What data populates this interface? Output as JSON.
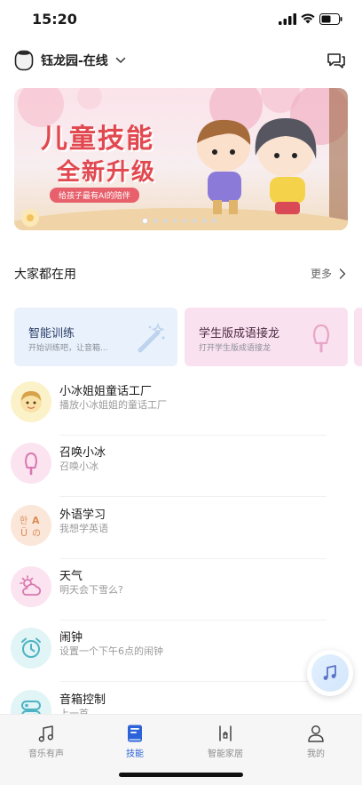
{
  "status_bar": {
    "time": "15:20"
  },
  "header": {
    "device_name": "钰龙园-在线"
  },
  "banner": {
    "title_line1": "儿童技能",
    "title_line2": "全新升级",
    "tagline": "给孩子最有AI的陪伴",
    "slide_count": 8,
    "active_slide": 1
  },
  "section": {
    "title": "大家都在用",
    "more_label": "更多"
  },
  "cards": [
    {
      "title": "智能训练",
      "subtitle": "开始训练吧，让音箱...",
      "icon": "magic-wand-icon",
      "color": "#e9f2fc"
    },
    {
      "title": "学生版成语接龙",
      "subtitle": "打开学生版成语接龙",
      "icon": "popsicle-icon",
      "color": "#fae1ef"
    }
  ],
  "list": [
    {
      "title": "小冰姐姐童话工厂",
      "subtitle": "播放小冰姐姐的童话工厂",
      "icon": "girl-avatar-icon",
      "bg": "#fbf2c9"
    },
    {
      "title": "召唤小冰",
      "subtitle": "召唤小冰",
      "icon": "popsicle-icon",
      "bg": "#fbe3f0"
    },
    {
      "title": "外语学习",
      "subtitle": "我想学英语",
      "icon": "language-icon",
      "bg": "#fbe7d9"
    },
    {
      "title": "天气",
      "subtitle": "明天会下雪么?",
      "icon": "weather-icon",
      "bg": "#fbe3f0"
    },
    {
      "title": "闹钟",
      "subtitle": "设置一个下午6点的闹钟",
      "icon": "alarm-clock-icon",
      "bg": "#e1f4f6"
    },
    {
      "title": "音箱控制",
      "subtitle": "上一首",
      "icon": "speaker-control-icon",
      "bg": "#e1f4f6"
    }
  ],
  "tabs": [
    {
      "label": "音乐有声",
      "icon": "music-note-icon",
      "active": false
    },
    {
      "label": "技能",
      "icon": "book-icon",
      "active": true
    },
    {
      "label": "智能家居",
      "icon": "smart-home-icon",
      "active": false
    },
    {
      "label": "我的",
      "icon": "person-icon",
      "active": false
    }
  ],
  "colors": {
    "accent": "#2d63d8",
    "banner_title": "#e2484f"
  }
}
